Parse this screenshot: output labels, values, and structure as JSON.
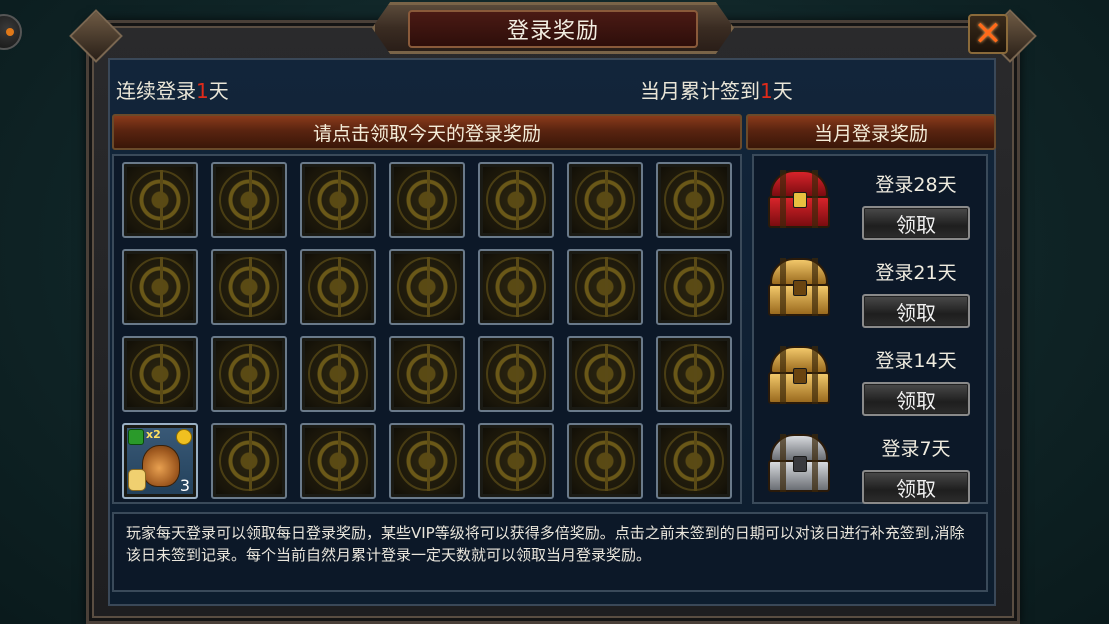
{
  "dialog": {
    "title": "登录奖励",
    "close_icon": "close-x-icon"
  },
  "stats": {
    "consecutive_prefix": "连续登录",
    "consecutive_days": "1",
    "consecutive_suffix": "天",
    "monthly_prefix": "当月累计签到",
    "monthly_days": "1",
    "monthly_suffix": "天"
  },
  "headers": {
    "daily": "请点击领取今天的登录奖励",
    "monthly": "当月登录奖励"
  },
  "daily_grid": {
    "rows": 4,
    "columns": 7,
    "special_item": {
      "badge": "x2",
      "count": "3",
      "icon": "money-bag-icon"
    }
  },
  "monthly_rewards": [
    {
      "label": "登录28天",
      "chest": "red-chest-icon",
      "button": "领取"
    },
    {
      "label": "登录21天",
      "chest": "gold-chest-icon",
      "button": "领取"
    },
    {
      "label": "登录14天",
      "chest": "gold-chest-icon",
      "button": "领取"
    },
    {
      "label": "登录7天",
      "chest": "silver-chest-icon",
      "button": "领取"
    }
  ],
  "description": "玩家每天登录可以领取每日登录奖励，某些VIP等级将可以获得多倍奖励。点击之前未签到的日期可以对该日进行补充签到,消除该日未签到记录。每个当前自然月累计登录一定天数就可以领取当月登录奖励。",
  "colors": {
    "accent_red": "#e02a1a",
    "close_orange": "#ff6a1a",
    "header_brown": "#5a2410"
  }
}
